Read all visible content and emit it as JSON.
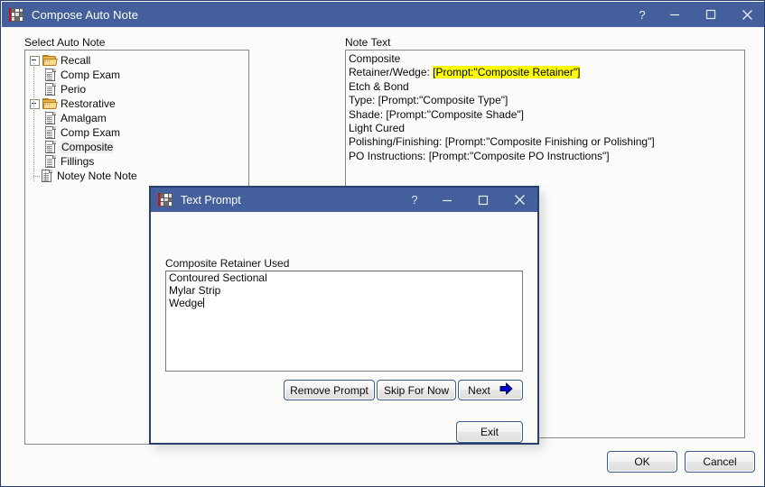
{
  "window": {
    "title": "Compose Auto Note",
    "icon": "app-grid-icon",
    "controls": {
      "help": "?",
      "minimize": "minimize-icon",
      "maximize": "maximize-icon",
      "close": "close-icon"
    }
  },
  "tree_section": {
    "label": "Select Auto Note",
    "items": [
      {
        "label": "Recall",
        "type": "folder",
        "depth": 0,
        "expanded": true,
        "selected": false
      },
      {
        "label": "Comp Exam",
        "type": "document",
        "depth": 1,
        "expanded": false,
        "selected": false
      },
      {
        "label": "Perio",
        "type": "document",
        "depth": 1,
        "expanded": false,
        "selected": false
      },
      {
        "label": "Restorative",
        "type": "folder",
        "depth": 0,
        "expanded": true,
        "selected": false
      },
      {
        "label": "Amalgam",
        "type": "document",
        "depth": 1,
        "expanded": false,
        "selected": false
      },
      {
        "label": "Comp Exam",
        "type": "document",
        "depth": 1,
        "expanded": false,
        "selected": false
      },
      {
        "label": "Composite",
        "type": "document",
        "depth": 1,
        "expanded": false,
        "selected": true
      },
      {
        "label": "Fillings",
        "type": "document",
        "depth": 1,
        "expanded": false,
        "selected": false
      },
      {
        "label": "Notey Note Note",
        "type": "document",
        "depth": 0,
        "expanded": false,
        "selected": false
      }
    ]
  },
  "note_section": {
    "label": "Note Text",
    "lines": [
      {
        "text": "Composite",
        "highlight": null
      },
      {
        "text": "Retainer/Wedge: ",
        "highlight": "[Prompt:\"Composite Retainer\"]"
      },
      {
        "text": "Etch & Bond",
        "highlight": null
      },
      {
        "text": "Type: [Prompt:\"Composite Type\"]",
        "highlight": null
      },
      {
        "text": "Shade: [Prompt:\"Composite Shade\"]",
        "highlight": null
      },
      {
        "text": "Light Cured",
        "highlight": null
      },
      {
        "text": "Polishing/Finishing: [Prompt:\"Composite Finishing or Polishing\"]",
        "highlight": null
      },
      {
        "text": "PO Instructions: [Prompt:\"Composite PO Instructions\"]",
        "highlight": null
      }
    ]
  },
  "main_buttons": {
    "ok": "OK",
    "cancel": "Cancel"
  },
  "dialog": {
    "title": "Text Prompt",
    "icon": "app-grid-icon",
    "controls": {
      "help": "?",
      "minimize": "minimize-icon",
      "maximize": "maximize-icon",
      "close": "close-icon"
    },
    "prompt_label": "Composite Retainer Used",
    "textarea_lines": [
      "Contoured Sectional",
      "Mylar Strip",
      "Wedge"
    ],
    "buttons": {
      "remove_prompt": "Remove Prompt",
      "skip_for_now": "Skip For Now",
      "next": "Next",
      "next_icon": "right-arrow-icon",
      "exit": "Exit"
    }
  },
  "colors": {
    "titlebar": "#44609c",
    "window_border": "#2a3f6b",
    "highlight": "#ffff00",
    "arrow": "#0000d8",
    "button_border": "#3a5b8c"
  }
}
